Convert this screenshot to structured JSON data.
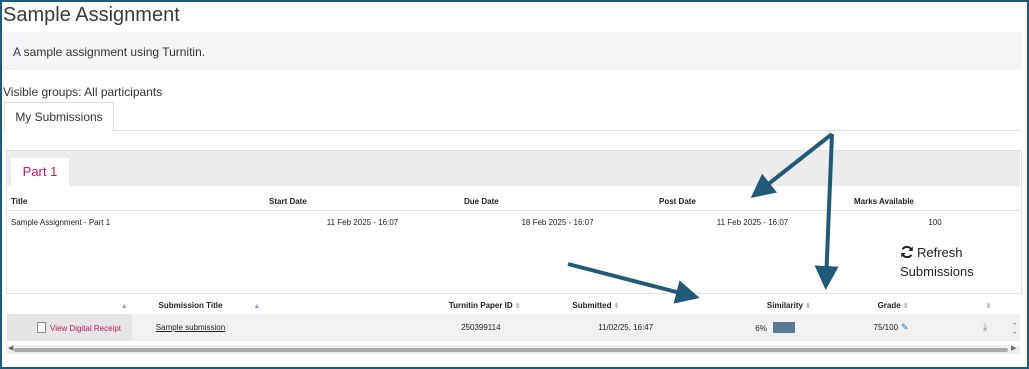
{
  "page": {
    "title": "Sample Assignment",
    "description": "A sample assignment using Turnitin.",
    "visible_groups": "Visible groups: All participants"
  },
  "tabs": {
    "my_submissions": "My Submissions",
    "part": "Part 1"
  },
  "assignment_info": {
    "headers": [
      "Title",
      "Start Date",
      "Due Date",
      "Post Date",
      "Marks Available"
    ],
    "row": [
      "Sample Assignment - Part 1",
      "11 Feb 2025 - 16:07",
      "18 Feb 2025 - 16:07",
      "11 Feb 2025 - 16:07",
      "100"
    ]
  },
  "refresh": {
    "line1": "Refresh",
    "line2": "Submissions",
    "icon": "refresh-icon"
  },
  "submissions": {
    "headers": {
      "submission_title": "Submission Title",
      "paper_id": "Turnitin Paper ID",
      "submitted": "Submitted",
      "similarity": "Similarity",
      "grade": "Grade"
    },
    "row": {
      "receipt": "View Digital Receipt",
      "title": "Sample submission",
      "paper_id": "250399114",
      "submitted": "11/02/25, 16:47",
      "similarity": "6%",
      "grade": "75/100",
      "extra": "--"
    }
  },
  "colors": {
    "accent": "#c2185b",
    "arrow": "#1f5a78",
    "similarity_bar": "#5a7a94"
  }
}
